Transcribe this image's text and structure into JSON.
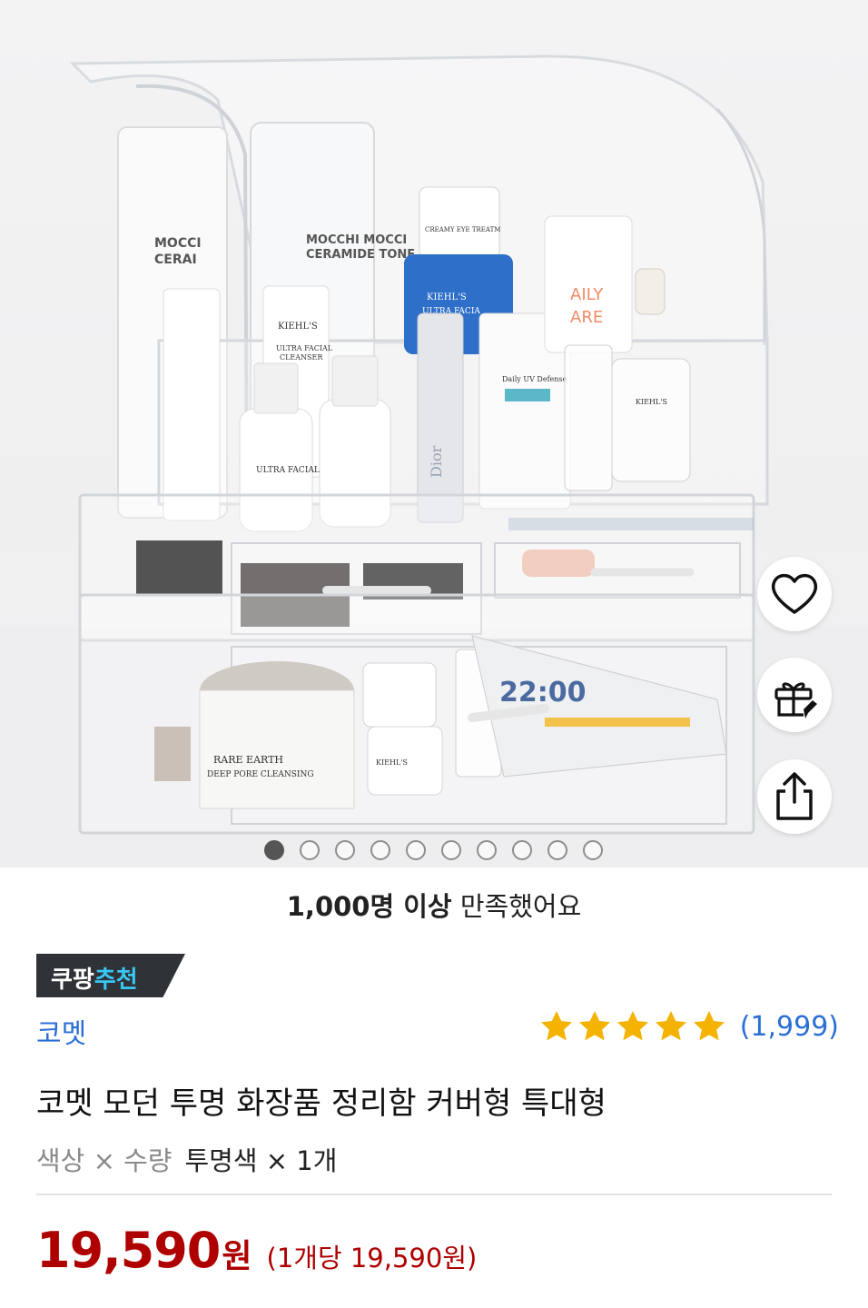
{
  "product_image": {
    "alt": "코멧 모던 투명 화장품 정리함 커버형 특대형",
    "box_labels": {
      "toner_left": "MOCCHI CERAMIDE",
      "toner_right": "MOCCHI MOCCHI CERAMIDE TONER",
      "kiehls": "KIEHL'S",
      "cleanser": "ULTRA FACIAL CLEANSER",
      "toner": "ULTRA FACIAL TONER",
      "cream_eye": "CREAMY EYE TREATMENT",
      "daily_uv": "Daily UV Defense",
      "daily_care": "DAILY CARE",
      "rare_earth": "RARE EARTH DEEP PORE CLEANSING MASQUE",
      "ultra_cream": "ULTRA FACIAL CREAM",
      "dior": "Dior",
      "pad": "22:00"
    },
    "carousel_total": 10,
    "carousel_active": 1
  },
  "actions": {
    "like_icon": "heart-icon",
    "gift_icon": "gift-icon",
    "share_icon": "share-icon"
  },
  "satisfaction": {
    "bold": "1,000명 이상",
    "rest": " 만족했어요"
  },
  "badge": {
    "part1": "쿠팡",
    "part2": "추천"
  },
  "brand": "코멧",
  "rating": {
    "stars": 5,
    "count": "(1,999)"
  },
  "title": "코멧 모던 투명 화장품 정리함 커버형 특대형",
  "options": {
    "label": "색상 × 수량",
    "value": "투명색 × 1개"
  },
  "price": {
    "amount": "19,590",
    "currency": "원",
    "unit_price": "(1개당 19,590원)"
  },
  "colors": {
    "brand_blue": "#2b6fd6",
    "price_red": "#ae0000",
    "star_yellow": "#f5b301",
    "badge_dark": "#2f3338",
    "badge_highlight": "#38c7f3"
  }
}
